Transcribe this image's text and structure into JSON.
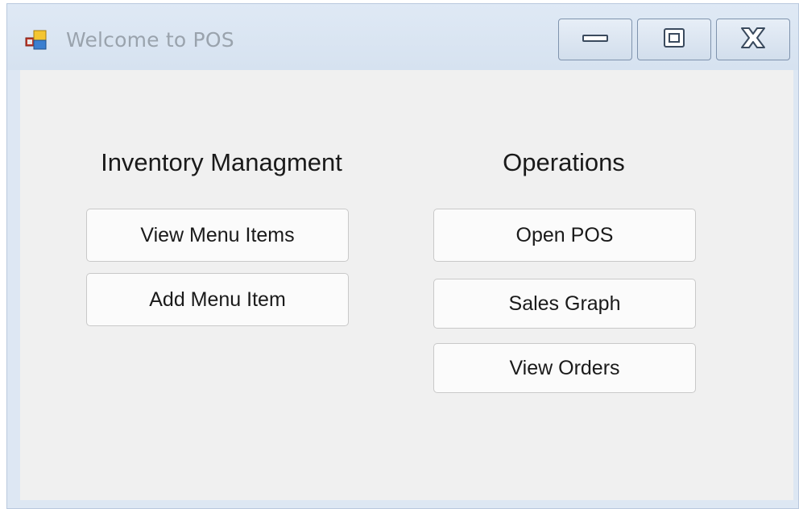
{
  "window": {
    "title": "Welcome to POS",
    "app_icon": "windows-form-icon",
    "controls": {
      "minimize_icon": "minimize-icon",
      "maximize_icon": "maximize-icon",
      "close_icon": "close-icon"
    }
  },
  "inventory": {
    "heading": "Inventory Managment",
    "buttons": [
      {
        "label": "View Menu Items"
      },
      {
        "label": "Add Menu Item"
      }
    ]
  },
  "operations": {
    "heading": "Operations",
    "buttons": [
      {
        "label": "Open POS"
      },
      {
        "label": "Sales Graph"
      },
      {
        "label": "View Orders"
      }
    ]
  },
  "colors": {
    "title_bar": "#dde7f3",
    "client_area": "#f0f0f0",
    "title_text": "#9aa3ad",
    "button_face": "#fbfbfb"
  }
}
